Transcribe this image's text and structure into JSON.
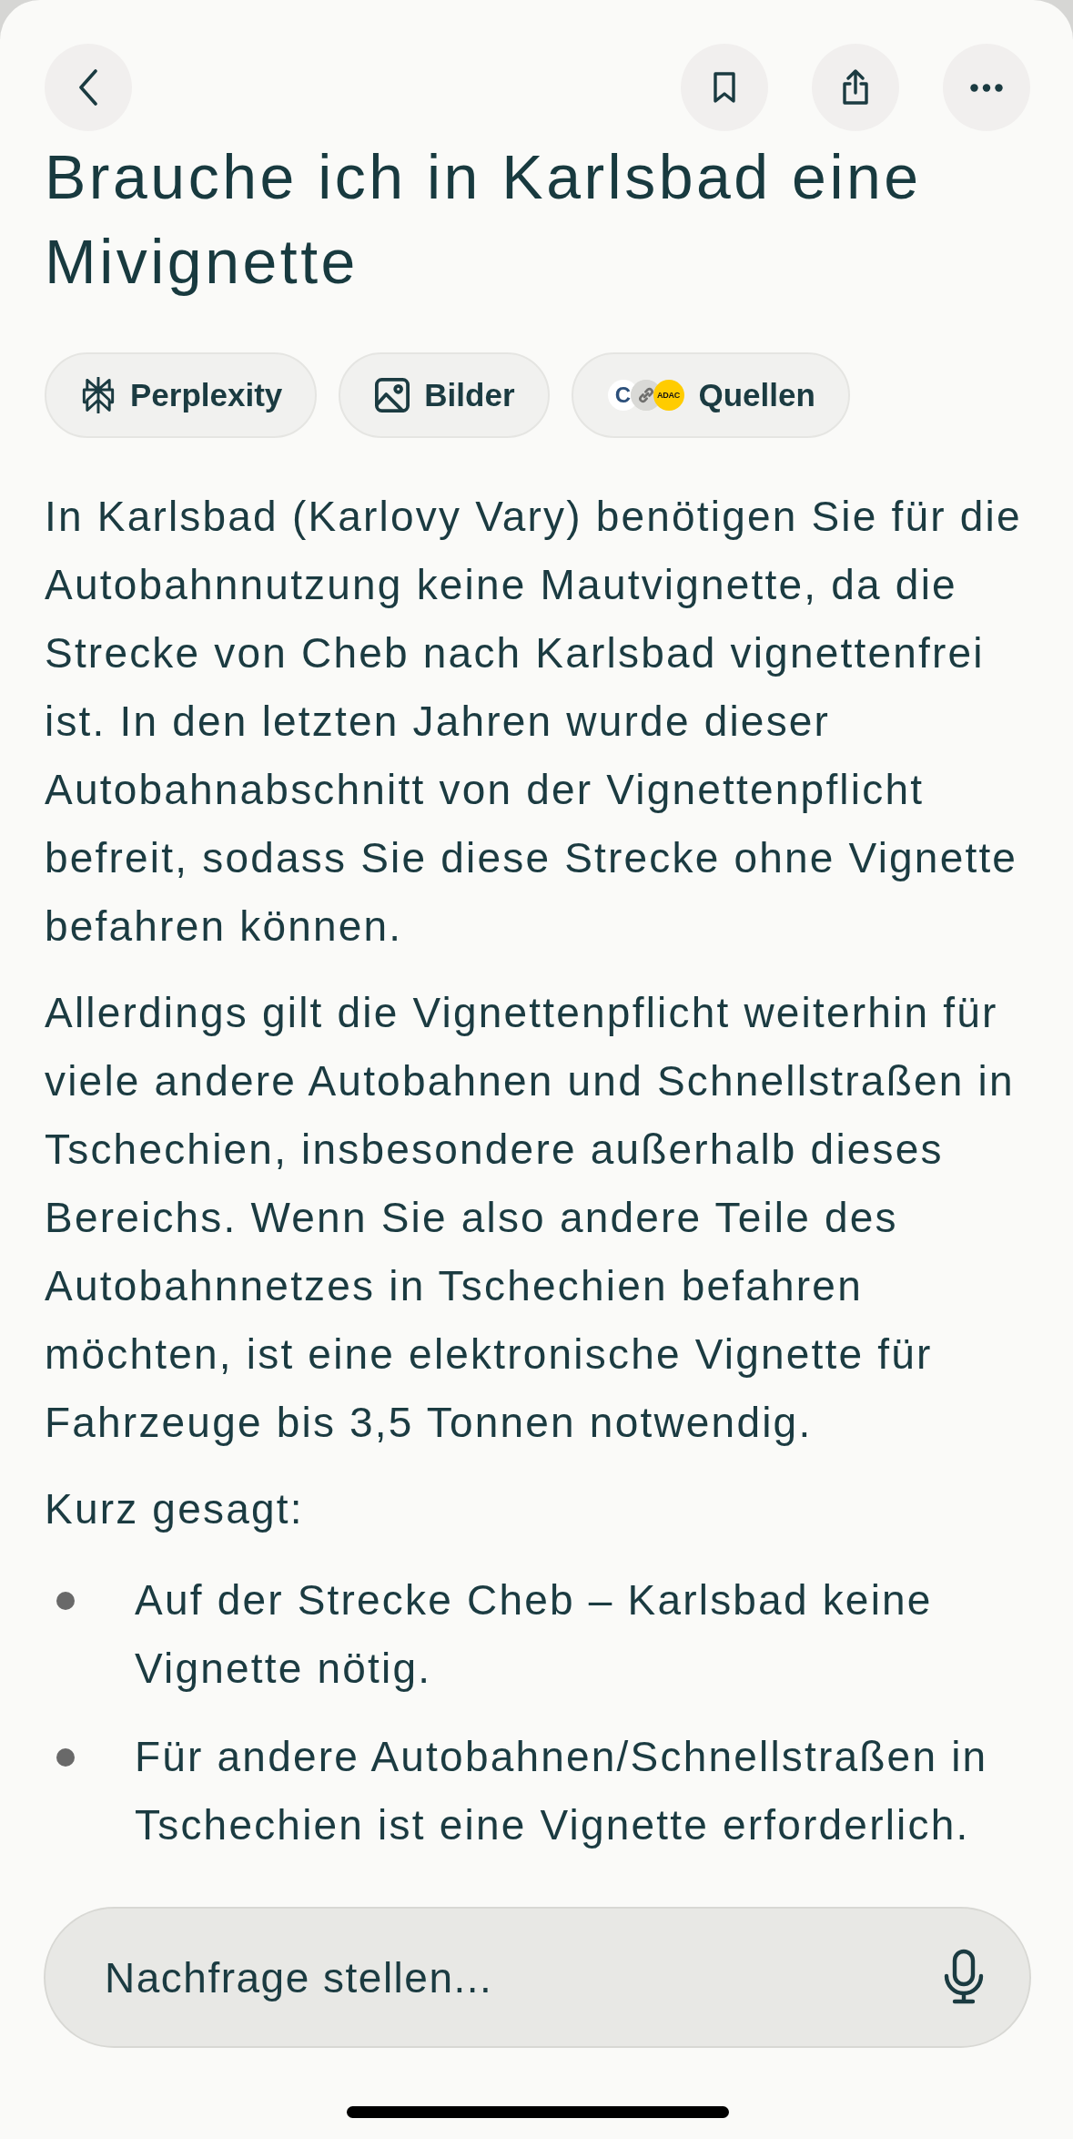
{
  "title": "Brauche ich in Karlsbad eine Mivignette",
  "chips": [
    {
      "kind": "perplexity",
      "label": "Perplexity"
    },
    {
      "kind": "images",
      "label": "Bilder"
    },
    {
      "kind": "sources",
      "label": "Quellen",
      "favicons": [
        {
          "kind": "letter",
          "label": "C"
        },
        {
          "kind": "link"
        },
        {
          "kind": "logo",
          "label": "ADAC"
        }
      ]
    }
  ],
  "answer": {
    "paragraphs": [
      "In Karlsbad (Karlovy Vary) benötigen Sie für die Autobahnnutzung keine Mautvignette, da die Strecke von Cheb nach Karlsbad vignettenfrei ist. In den letzten Jahren wurde dieser Autobahnabschnitt von der Vignettenpflicht befreit, sodass Sie diese Strecke ohne Vignette befahren können.",
      "Allerdings gilt die Vignettenpflicht weiterhin für viele andere Autobahnen und Schnellstraßen in Tschechien, insbesondere außerhalb dieses Bereichs. Wenn Sie also andere Teile des Autobahnnetzes in Tschechien befahren möchten, ist eine elektronische Vignette für Fahrzeuge bis 3,5 Tonnen notwendig."
    ],
    "summary_intro": "Kurz gesagt:",
    "bullets": [
      "Auf der Strecke Cheb – Karlsbad keine Vignette nötig.",
      "Für andere Autobahnen/Schnellstraßen in Tschechien ist eine Vignette erforderlich."
    ]
  },
  "follow_up": {
    "placeholder": "Nachfrage stellen..."
  }
}
